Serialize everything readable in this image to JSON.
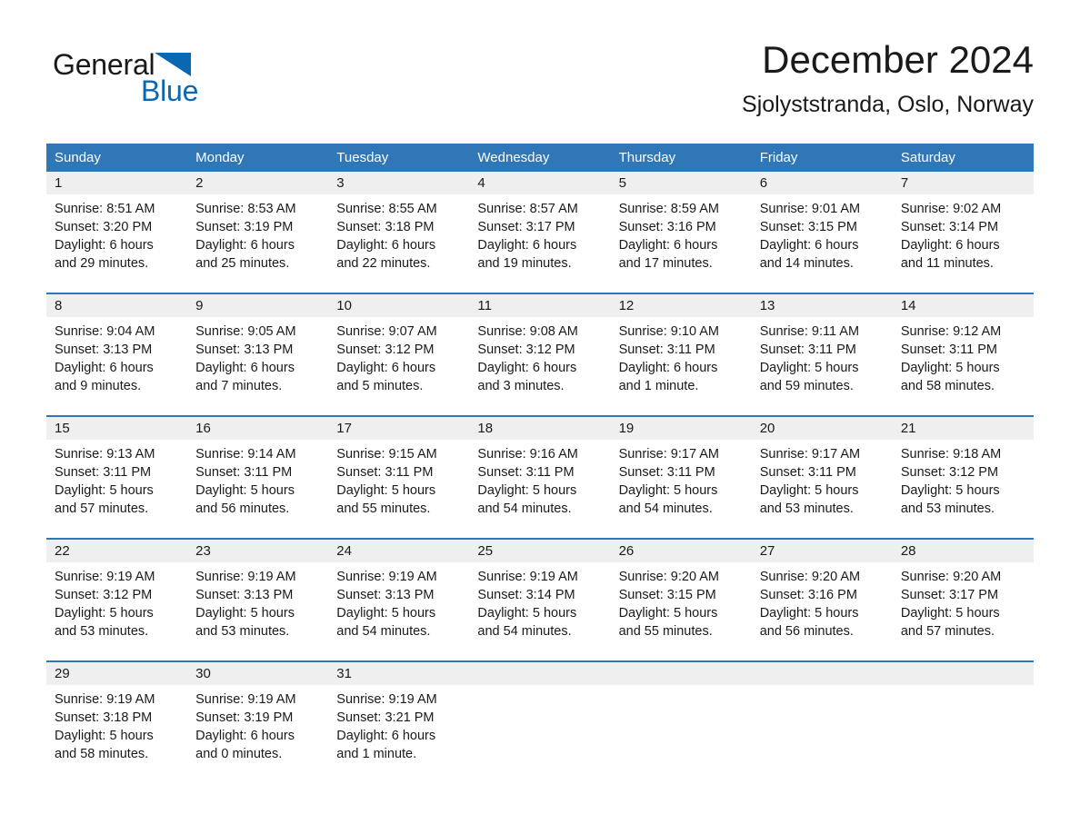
{
  "brand": {
    "line1_word": "General",
    "line2_word": "Blue",
    "triangle_color": "#0a67b1"
  },
  "header": {
    "title": "December 2024",
    "subtitle": "Sjolyststranda, Oslo, Norway"
  },
  "theme": {
    "header_blue": "#3077b8",
    "day_band_gray": "#efefef",
    "text": "#1a1a1a"
  },
  "weekdays": [
    "Sunday",
    "Monday",
    "Tuesday",
    "Wednesday",
    "Thursday",
    "Friday",
    "Saturday"
  ],
  "weeks": [
    [
      {
        "day": "1",
        "sunrise": "Sunrise: 8:51 AM",
        "sunset": "Sunset: 3:20 PM",
        "daylight1": "Daylight: 6 hours",
        "daylight2": "and 29 minutes."
      },
      {
        "day": "2",
        "sunrise": "Sunrise: 8:53 AM",
        "sunset": "Sunset: 3:19 PM",
        "daylight1": "Daylight: 6 hours",
        "daylight2": "and 25 minutes."
      },
      {
        "day": "3",
        "sunrise": "Sunrise: 8:55 AM",
        "sunset": "Sunset: 3:18 PM",
        "daylight1": "Daylight: 6 hours",
        "daylight2": "and 22 minutes."
      },
      {
        "day": "4",
        "sunrise": "Sunrise: 8:57 AM",
        "sunset": "Sunset: 3:17 PM",
        "daylight1": "Daylight: 6 hours",
        "daylight2": "and 19 minutes."
      },
      {
        "day": "5",
        "sunrise": "Sunrise: 8:59 AM",
        "sunset": "Sunset: 3:16 PM",
        "daylight1": "Daylight: 6 hours",
        "daylight2": "and 17 minutes."
      },
      {
        "day": "6",
        "sunrise": "Sunrise: 9:01 AM",
        "sunset": "Sunset: 3:15 PM",
        "daylight1": "Daylight: 6 hours",
        "daylight2": "and 14 minutes."
      },
      {
        "day": "7",
        "sunrise": "Sunrise: 9:02 AM",
        "sunset": "Sunset: 3:14 PM",
        "daylight1": "Daylight: 6 hours",
        "daylight2": "and 11 minutes."
      }
    ],
    [
      {
        "day": "8",
        "sunrise": "Sunrise: 9:04 AM",
        "sunset": "Sunset: 3:13 PM",
        "daylight1": "Daylight: 6 hours",
        "daylight2": "and 9 minutes."
      },
      {
        "day": "9",
        "sunrise": "Sunrise: 9:05 AM",
        "sunset": "Sunset: 3:13 PM",
        "daylight1": "Daylight: 6 hours",
        "daylight2": "and 7 minutes."
      },
      {
        "day": "10",
        "sunrise": "Sunrise: 9:07 AM",
        "sunset": "Sunset: 3:12 PM",
        "daylight1": "Daylight: 6 hours",
        "daylight2": "and 5 minutes."
      },
      {
        "day": "11",
        "sunrise": "Sunrise: 9:08 AM",
        "sunset": "Sunset: 3:12 PM",
        "daylight1": "Daylight: 6 hours",
        "daylight2": "and 3 minutes."
      },
      {
        "day": "12",
        "sunrise": "Sunrise: 9:10 AM",
        "sunset": "Sunset: 3:11 PM",
        "daylight1": "Daylight: 6 hours",
        "daylight2": "and 1 minute."
      },
      {
        "day": "13",
        "sunrise": "Sunrise: 9:11 AM",
        "sunset": "Sunset: 3:11 PM",
        "daylight1": "Daylight: 5 hours",
        "daylight2": "and 59 minutes."
      },
      {
        "day": "14",
        "sunrise": "Sunrise: 9:12 AM",
        "sunset": "Sunset: 3:11 PM",
        "daylight1": "Daylight: 5 hours",
        "daylight2": "and 58 minutes."
      }
    ],
    [
      {
        "day": "15",
        "sunrise": "Sunrise: 9:13 AM",
        "sunset": "Sunset: 3:11 PM",
        "daylight1": "Daylight: 5 hours",
        "daylight2": "and 57 minutes."
      },
      {
        "day": "16",
        "sunrise": "Sunrise: 9:14 AM",
        "sunset": "Sunset: 3:11 PM",
        "daylight1": "Daylight: 5 hours",
        "daylight2": "and 56 minutes."
      },
      {
        "day": "17",
        "sunrise": "Sunrise: 9:15 AM",
        "sunset": "Sunset: 3:11 PM",
        "daylight1": "Daylight: 5 hours",
        "daylight2": "and 55 minutes."
      },
      {
        "day": "18",
        "sunrise": "Sunrise: 9:16 AM",
        "sunset": "Sunset: 3:11 PM",
        "daylight1": "Daylight: 5 hours",
        "daylight2": "and 54 minutes."
      },
      {
        "day": "19",
        "sunrise": "Sunrise: 9:17 AM",
        "sunset": "Sunset: 3:11 PM",
        "daylight1": "Daylight: 5 hours",
        "daylight2": "and 54 minutes."
      },
      {
        "day": "20",
        "sunrise": "Sunrise: 9:17 AM",
        "sunset": "Sunset: 3:11 PM",
        "daylight1": "Daylight: 5 hours",
        "daylight2": "and 53 minutes."
      },
      {
        "day": "21",
        "sunrise": "Sunrise: 9:18 AM",
        "sunset": "Sunset: 3:12 PM",
        "daylight1": "Daylight: 5 hours",
        "daylight2": "and 53 minutes."
      }
    ],
    [
      {
        "day": "22",
        "sunrise": "Sunrise: 9:19 AM",
        "sunset": "Sunset: 3:12 PM",
        "daylight1": "Daylight: 5 hours",
        "daylight2": "and 53 minutes."
      },
      {
        "day": "23",
        "sunrise": "Sunrise: 9:19 AM",
        "sunset": "Sunset: 3:13 PM",
        "daylight1": "Daylight: 5 hours",
        "daylight2": "and 53 minutes."
      },
      {
        "day": "24",
        "sunrise": "Sunrise: 9:19 AM",
        "sunset": "Sunset: 3:13 PM",
        "daylight1": "Daylight: 5 hours",
        "daylight2": "and 54 minutes."
      },
      {
        "day": "25",
        "sunrise": "Sunrise: 9:19 AM",
        "sunset": "Sunset: 3:14 PM",
        "daylight1": "Daylight: 5 hours",
        "daylight2": "and 54 minutes."
      },
      {
        "day": "26",
        "sunrise": "Sunrise: 9:20 AM",
        "sunset": "Sunset: 3:15 PM",
        "daylight1": "Daylight: 5 hours",
        "daylight2": "and 55 minutes."
      },
      {
        "day": "27",
        "sunrise": "Sunrise: 9:20 AM",
        "sunset": "Sunset: 3:16 PM",
        "daylight1": "Daylight: 5 hours",
        "daylight2": "and 56 minutes."
      },
      {
        "day": "28",
        "sunrise": "Sunrise: 9:20 AM",
        "sunset": "Sunset: 3:17 PM",
        "daylight1": "Daylight: 5 hours",
        "daylight2": "and 57 minutes."
      }
    ],
    [
      {
        "day": "29",
        "sunrise": "Sunrise: 9:19 AM",
        "sunset": "Sunset: 3:18 PM",
        "daylight1": "Daylight: 5 hours",
        "daylight2": "and 58 minutes."
      },
      {
        "day": "30",
        "sunrise": "Sunrise: 9:19 AM",
        "sunset": "Sunset: 3:19 PM",
        "daylight1": "Daylight: 6 hours",
        "daylight2": "and 0 minutes."
      },
      {
        "day": "31",
        "sunrise": "Sunrise: 9:19 AM",
        "sunset": "Sunset: 3:21 PM",
        "daylight1": "Daylight: 6 hours",
        "daylight2": "and 1 minute."
      },
      {
        "day": "",
        "sunrise": "",
        "sunset": "",
        "daylight1": "",
        "daylight2": ""
      },
      {
        "day": "",
        "sunrise": "",
        "sunset": "",
        "daylight1": "",
        "daylight2": ""
      },
      {
        "day": "",
        "sunrise": "",
        "sunset": "",
        "daylight1": "",
        "daylight2": ""
      },
      {
        "day": "",
        "sunrise": "",
        "sunset": "",
        "daylight1": "",
        "daylight2": ""
      }
    ]
  ]
}
